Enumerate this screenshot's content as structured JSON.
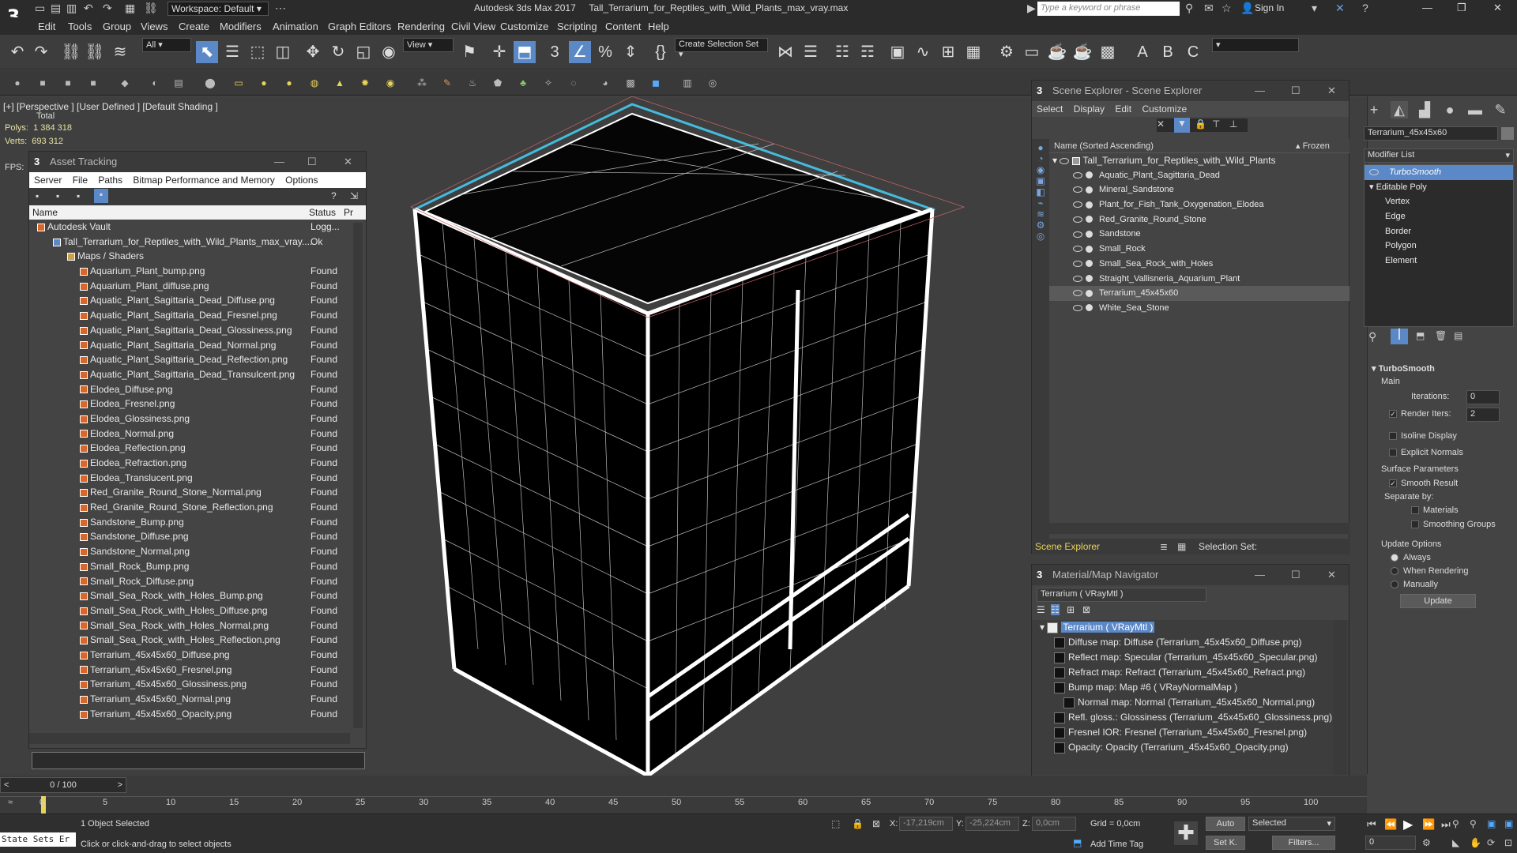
{
  "app": {
    "title": "Autodesk 3ds Max 2017",
    "file": "Tall_Terrarium_for_Reptiles_with_Wild_Plants_max_vray.max",
    "workspace": "Workspace: Default",
    "search_placeholder": "Type a keyword or phrase",
    "sign_in": "Sign In"
  },
  "menu": [
    "Edit",
    "Tools",
    "Group",
    "Views",
    "Create",
    "Modifiers",
    "Animation",
    "Graph Editors",
    "Rendering",
    "Civil View",
    "Customize",
    "Scripting",
    "Content",
    "Help"
  ],
  "toolbar": {
    "filter": "All",
    "view": "View",
    "selection_set": "Create Selection Set"
  },
  "viewport": {
    "label": "[+] [Perspective ] [User Defined ] [Default Shading ]",
    "total": "Total",
    "polys_label": "Polys:",
    "polys": "1 384 318",
    "verts_label": "Verts:",
    "verts": "693 312",
    "fps_label": "FPS:"
  },
  "asset_tracking": {
    "title": "Asset Tracking",
    "menu": [
      "Server",
      "File",
      "Paths",
      "Bitmap Performance and Memory",
      "Options"
    ],
    "col_name": "Name",
    "col_status": "Status",
    "col_pr": "Pr",
    "vault": {
      "name": "Autodesk Vault",
      "status": "Logg..."
    },
    "file": {
      "name": "Tall_Terrarium_for_Reptiles_with_Wild_Plants_max_vray....",
      "status": "Ok"
    },
    "maps": "Maps / Shaders",
    "items": [
      {
        "name": "Aquarium_Plant_bump.png",
        "status": "Found"
      },
      {
        "name": "Aquarium_Plant_diffuse.png",
        "status": "Found"
      },
      {
        "name": "Aquatic_Plant_Sagittaria_Dead_Diffuse.png",
        "status": "Found"
      },
      {
        "name": "Aquatic_Plant_Sagittaria_Dead_Fresnel.png",
        "status": "Found"
      },
      {
        "name": "Aquatic_Plant_Sagittaria_Dead_Glossiness.png",
        "status": "Found"
      },
      {
        "name": "Aquatic_Plant_Sagittaria_Dead_Normal.png",
        "status": "Found"
      },
      {
        "name": "Aquatic_Plant_Sagittaria_Dead_Reflection.png",
        "status": "Found"
      },
      {
        "name": "Aquatic_Plant_Sagittaria_Dead_Transulcent.png",
        "status": "Found"
      },
      {
        "name": "Elodea_Diffuse.png",
        "status": "Found"
      },
      {
        "name": "Elodea_Fresnel.png",
        "status": "Found"
      },
      {
        "name": "Elodea_Glossiness.png",
        "status": "Found"
      },
      {
        "name": "Elodea_Normal.png",
        "status": "Found"
      },
      {
        "name": "Elodea_Reflection.png",
        "status": "Found"
      },
      {
        "name": "Elodea_Refraction.png",
        "status": "Found"
      },
      {
        "name": "Elodea_Translucent.png",
        "status": "Found"
      },
      {
        "name": "Red_Granite_Round_Stone_Normal.png",
        "status": "Found"
      },
      {
        "name": "Red_Granite_Round_Stone_Reflection.png",
        "status": "Found"
      },
      {
        "name": "Sandstone_Bump.png",
        "status": "Found"
      },
      {
        "name": "Sandstone_Diffuse.png",
        "status": "Found"
      },
      {
        "name": "Sandstone_Normal.png",
        "status": "Found"
      },
      {
        "name": "Small_Rock_Bump.png",
        "status": "Found"
      },
      {
        "name": "Small_Rock_Diffuse.png",
        "status": "Found"
      },
      {
        "name": "Small_Sea_Rock_with_Holes_Bump.png",
        "status": "Found"
      },
      {
        "name": "Small_Sea_Rock_with_Holes_Diffuse.png",
        "status": "Found"
      },
      {
        "name": "Small_Sea_Rock_with_Holes_Normal.png",
        "status": "Found"
      },
      {
        "name": "Small_Sea_Rock_with_Holes_Reflection.png",
        "status": "Found"
      },
      {
        "name": "Terrarium_45x45x60_Diffuse.png",
        "status": "Found"
      },
      {
        "name": "Terrarium_45x45x60_Fresnel.png",
        "status": "Found"
      },
      {
        "name": "Terrarium_45x45x60_Glossiness.png",
        "status": "Found"
      },
      {
        "name": "Terrarium_45x45x60_Normal.png",
        "status": "Found"
      },
      {
        "name": "Terrarium_45x45x60_Opacity.png",
        "status": "Found"
      }
    ]
  },
  "scene_explorer": {
    "title": "Scene Explorer - Scene Explorer",
    "menu": [
      "Select",
      "Display",
      "Edit",
      "Customize"
    ],
    "col_name": "Name (Sorted Ascending)",
    "col_frozen": "▴ Frozen",
    "root": "Tall_Terrarium_for_Reptiles_with_Wild_Plants",
    "items": [
      "Aquatic_Plant_Sagittaria_Dead",
      "Mineral_Sandstone",
      "Plant_for_Fish_Tank_Oxygenation_Elodea",
      "Red_Granite_Round_Stone",
      "Sandstone",
      "Small_Rock",
      "Small_Sea_Rock_with_Holes",
      "Straight_Vallisneria_Aquarium_Plant",
      "Terrarium_45x45x60",
      "White_Sea_Stone"
    ],
    "footer_label": "Scene Explorer",
    "selection_set": "Selection Set:"
  },
  "material_nav": {
    "title": "Material/Map Navigator",
    "field": "Terrarium  ( VRayMtl )",
    "root": "Terrarium  ( VRayMtl )",
    "items": [
      "Diffuse map: Diffuse (Terrarium_45x45x60_Diffuse.png)",
      "Reflect map: Specular (Terrarium_45x45x60_Specular.png)",
      "Refract map: Refract (Terrarium_45x45x60_Refract.png)",
      "Bump map: Map #6  ( VRayNormalMap )",
      "Normal map: Normal (Terrarium_45x45x60_Normal.png)",
      "Refl. gloss.: Glossiness (Terrarium_45x45x60_Glossiness.png)",
      "Fresnel IOR: Fresnel (Terrarium_45x45x60_Fresnel.png)",
      "Opacity: Opacity (Terrarium_45x45x60_Opacity.png)"
    ]
  },
  "command_panel": {
    "object_name": "Terrarium_45x45x60",
    "modifier_list": "Modifier List",
    "stack": [
      "TurboSmooth",
      "Editable Poly",
      "Vertex",
      "Edge",
      "Border",
      "Polygon",
      "Element"
    ],
    "turbosmooth": "TurboSmooth",
    "main": "Main",
    "iterations_label": "Iterations:",
    "iterations": "0",
    "render_iters_label": "Render Iters:",
    "render_iters": "2",
    "isoline": "Isoline Display",
    "explicit": "Explicit Normals",
    "surface": "Surface Parameters",
    "smooth_result": "Smooth Result",
    "separate_by": "Separate by:",
    "materials": "Materials",
    "smoothing_groups": "Smoothing Groups",
    "update_options": "Update Options",
    "always": "Always",
    "when_rendering": "When Rendering",
    "manually": "Manually",
    "update": "Update"
  },
  "timeline": {
    "frame": "0 / 100",
    "ticks": [
      "0",
      "5",
      "10",
      "15",
      "20",
      "25",
      "30",
      "35",
      "40",
      "45",
      "50",
      "55",
      "60",
      "65",
      "70",
      "75",
      "80",
      "85",
      "90",
      "95",
      "100"
    ]
  },
  "statusbar": {
    "state_sets": "State Sets Er",
    "selected": "1 Object Selected",
    "hint": "Click or click-and-drag to select objects",
    "x_label": "X:",
    "x": "-17,219cm",
    "y_label": "Y:",
    "y": "-25,224cm",
    "z_label": "Z:",
    "z": "0,0cm",
    "grid": "Grid = 0,0cm",
    "add_time_tag": "Add Time Tag",
    "auto": "Auto",
    "set_k": "Set K.",
    "selected_dd": "Selected",
    "filters": "Filters...",
    "frame_field": "0"
  }
}
